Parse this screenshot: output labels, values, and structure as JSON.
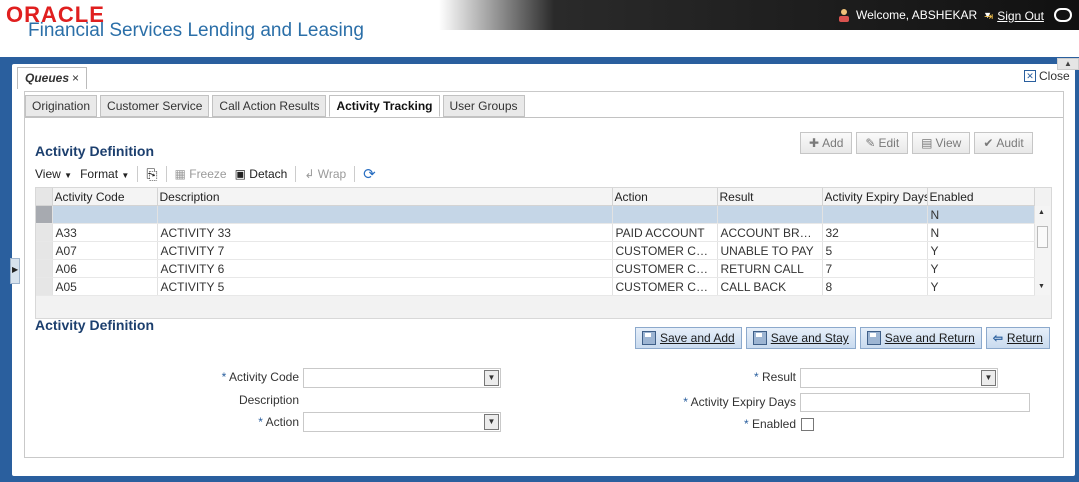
{
  "header": {
    "logo": "ORACLE",
    "product": "Financial Services Lending and Leasing",
    "welcome": "Welcome, ABSHEKAR",
    "sign_out": "Sign Out"
  },
  "queues_tab": {
    "label": "Queues",
    "close_glyph": "×"
  },
  "close_link": "Close",
  "tabs": [
    {
      "label": "Origination"
    },
    {
      "label": "Customer Service"
    },
    {
      "label": "Call Action Results"
    },
    {
      "label": "Activity Tracking"
    },
    {
      "label": "User Groups"
    }
  ],
  "section_title": "Activity Definition",
  "top_buttons": {
    "add": "Add",
    "edit": "Edit",
    "view": "View",
    "audit": "Audit"
  },
  "toolbar": {
    "view": "View",
    "format": "Format",
    "freeze": "Freeze",
    "detach": "Detach",
    "wrap": "Wrap"
  },
  "grid": {
    "columns": [
      "Activity Code",
      "Description",
      "Action",
      "Result",
      "Activity Expiry Days",
      "Enabled"
    ],
    "rows": [
      [
        "",
        "",
        "",
        "",
        "",
        "N"
      ],
      [
        "A33",
        "ACTIVITY 33",
        "PAID ACCOUNT",
        "ACCOUNT BROUG...",
        "32",
        "N"
      ],
      [
        "A07",
        "ACTIVITY 7",
        "CUSTOMER CALLED",
        "UNABLE TO PAY",
        "5",
        "Y"
      ],
      [
        "A06",
        "ACTIVITY 6",
        "CUSTOMER CALLED",
        "RETURN CALL",
        "7",
        "Y"
      ],
      [
        "A05",
        "ACTIVITY 5",
        "CUSTOMER CALLED",
        "CALL BACK",
        "8",
        "Y"
      ]
    ]
  },
  "form_title": "Activity Definition",
  "form_buttons": {
    "save_add": "Save and Add",
    "save_stay": "Save and Stay",
    "save_return": "Save and Return",
    "return": "Return"
  },
  "form": {
    "activity_code": "Activity Code",
    "description": "Description",
    "action": "Action",
    "result": "Result",
    "expiry_days": "Activity Expiry Days",
    "enabled": "Enabled",
    "required_mark": "*"
  },
  "colors": {
    "frame": "#2a5f9e",
    "title": "#1c3f6e",
    "selected_row": "#c5d6e7"
  }
}
